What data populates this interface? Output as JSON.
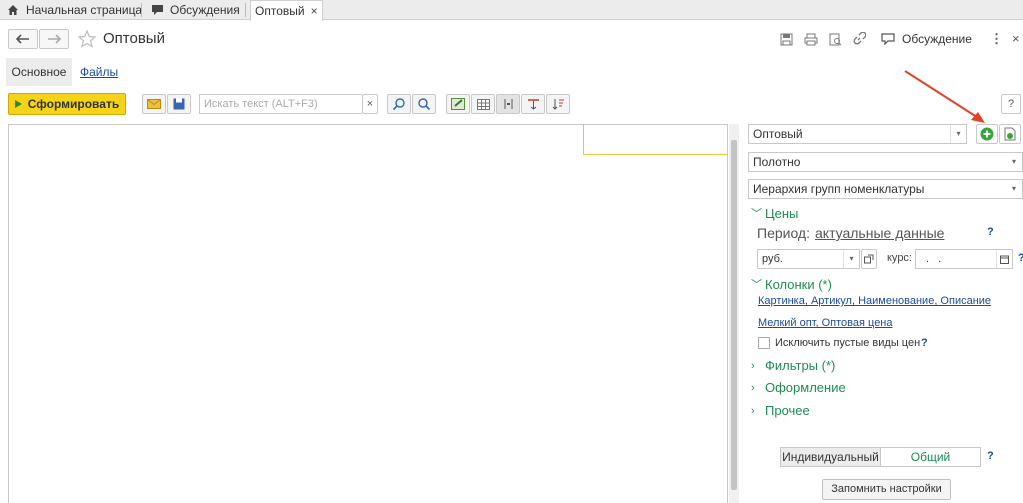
{
  "tabs": [
    {
      "label": "Начальная страница",
      "icon": "home-icon"
    },
    {
      "label": "Обсуждения",
      "icon": "chat-icon"
    },
    {
      "label": "Оптовый",
      "icon": "",
      "close": "×"
    }
  ],
  "header": {
    "title": "Оптовый",
    "discussion_label": "Обсуждение",
    "more": "⋮",
    "close": "×"
  },
  "subtabs": {
    "main": "Основное",
    "files": "Файлы"
  },
  "toolbar": {
    "generate_label": "Сформировать",
    "search_placeholder": "Искать текст (ALT+F3)",
    "search_clear": "×",
    "help": "?"
  },
  "panel": {
    "variant": "Оптовый",
    "layout": "Полотно",
    "grouping": "Иерархия групп номенклатуры",
    "prices_section": "Цены",
    "period_label": "Период:",
    "period_value": "актуальные данные",
    "currency": "руб.",
    "rate_label": "курс:",
    "rate_value": ". .",
    "columns_section": "Колонки (*)",
    "columns_link1": "Картинка, Артикул, Наименование, Описание",
    "columns_link2": "Мелкий опт, Оптовая цена",
    "exclude_empty": "Исключить пустые виды цен",
    "filters_section": "Фильтры (*)",
    "design_section": "Оформление",
    "other_section": "Прочее",
    "mode_individual": "Индивидуальный",
    "mode_common": "Общий",
    "save_settings": "Запомнить настройки",
    "q": "?"
  },
  "colors": {
    "accent_green": "#1d8c52",
    "generate_yellow": "#f5d418",
    "link_blue": "#1a4c9c",
    "arrow_red": "#e0432a"
  }
}
